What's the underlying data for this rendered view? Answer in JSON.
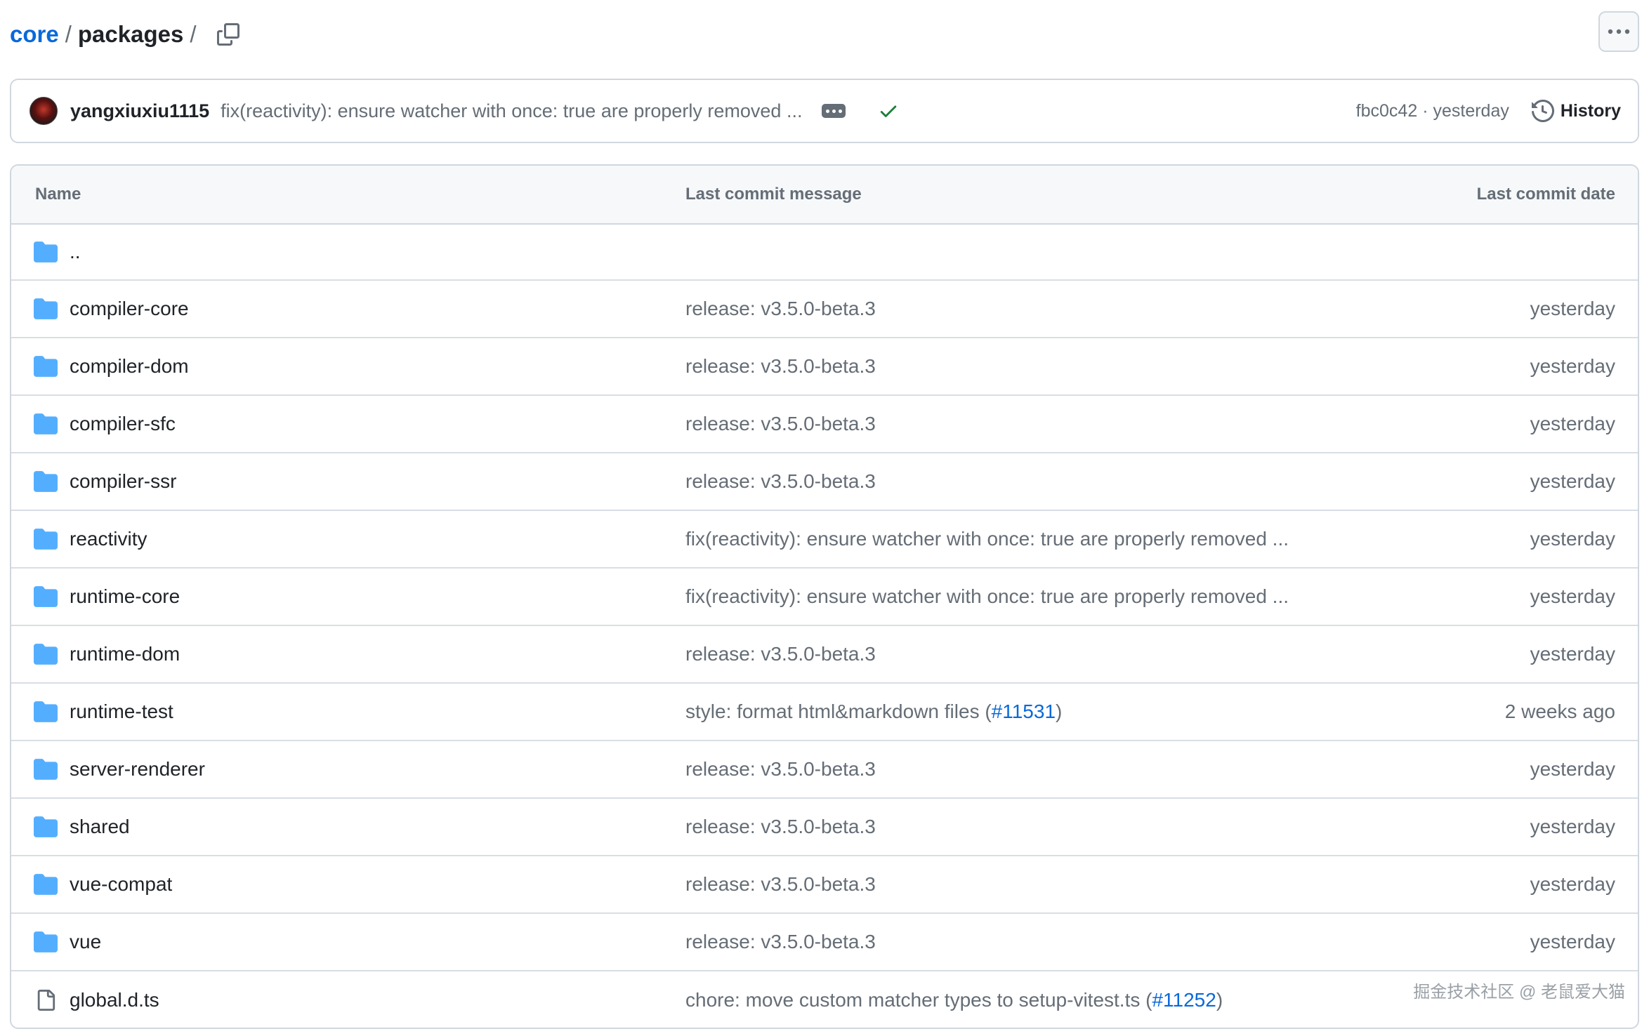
{
  "breadcrumb": {
    "repo": "core",
    "sep1": "/",
    "folder": "packages",
    "sep2": "/",
    "copy_icon": "copy-icon"
  },
  "more_icon": "kebab-horizontal-icon",
  "latest_commit": {
    "author": "yangxiuxiu1115",
    "message": "fix(reactivity): ensure watcher with once: true are properly removed ...",
    "status": "success",
    "sha": "fbc0c42",
    "separator": "·",
    "date": "yesterday",
    "history_label": "History"
  },
  "table": {
    "headers": {
      "name": "Name",
      "message": "Last commit message",
      "date": "Last commit date"
    },
    "parent_label": "..",
    "rows": [
      {
        "name": "compiler-core",
        "type": "folder",
        "message": "release: v3.5.0-beta.3",
        "date": "yesterday"
      },
      {
        "name": "compiler-dom",
        "type": "folder",
        "message": "release: v3.5.0-beta.3",
        "date": "yesterday"
      },
      {
        "name": "compiler-sfc",
        "type": "folder",
        "message": "release: v3.5.0-beta.3",
        "date": "yesterday"
      },
      {
        "name": "compiler-ssr",
        "type": "folder",
        "message": "release: v3.5.0-beta.3",
        "date": "yesterday"
      },
      {
        "name": "reactivity",
        "type": "folder",
        "message": "fix(reactivity): ensure watcher with once: true are properly removed ...",
        "date": "yesterday"
      },
      {
        "name": "runtime-core",
        "type": "folder",
        "message": "fix(reactivity): ensure watcher with once: true are properly removed ...",
        "date": "yesterday"
      },
      {
        "name": "runtime-dom",
        "type": "folder",
        "message": "release: v3.5.0-beta.3",
        "date": "yesterday"
      },
      {
        "name": "runtime-test",
        "type": "folder",
        "message_prefix": "style: format html&markdown files (",
        "pr": "#11531",
        "message_suffix": ")",
        "date": "2 weeks ago"
      },
      {
        "name": "server-renderer",
        "type": "folder",
        "message": "release: v3.5.0-beta.3",
        "date": "yesterday"
      },
      {
        "name": "shared",
        "type": "folder",
        "message": "release: v3.5.0-beta.3",
        "date": "yesterday"
      },
      {
        "name": "vue-compat",
        "type": "folder",
        "message": "release: v3.5.0-beta.3",
        "date": "yesterday"
      },
      {
        "name": "vue",
        "type": "folder",
        "message": "release: v3.5.0-beta.3",
        "date": "yesterday"
      },
      {
        "name": "global.d.ts",
        "type": "file",
        "message_prefix": "chore: move custom matcher types to setup-vitest.ts (",
        "pr": "#11252",
        "message_suffix": ")",
        "date": ""
      }
    ]
  },
  "watermark": "掘金技术社区 @ 老鼠爱大猫",
  "colors": {
    "link": "#0969da",
    "muted": "#656d76",
    "folder": "#54aeff",
    "success": "#1a7f37",
    "border": "#d0d7de"
  }
}
